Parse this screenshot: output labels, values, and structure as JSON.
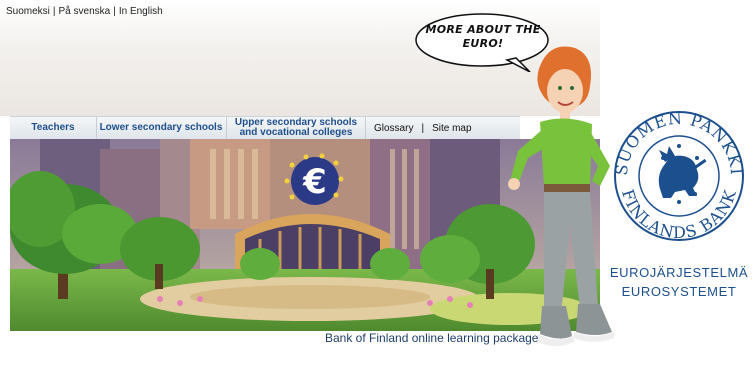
{
  "language_bar": {
    "items": [
      "Suomeksi",
      "På svenska",
      "In English"
    ],
    "separator": "|"
  },
  "nav": {
    "teachers": "Teachers",
    "lower_secondary": "Lower secondary schools",
    "upper_secondary": "Upper secondary schools and vocational colleges",
    "glossary": "Glossary",
    "separator": "|",
    "site_map": "Site map"
  },
  "speech_bubble": {
    "text": "MORE ABOUT THE EURO!"
  },
  "caption": "Bank of Finland online learning package",
  "logo": {
    "ring_text_top": "SUOMEN PANKKI",
    "ring_text_bottom": "FINLANDS BANK",
    "line1": "EUROJÄRJESTELMÄ",
    "line2": "EUROSYSTEMET",
    "color": "#1b4f8e"
  },
  "colors": {
    "nav_text": "#1f4f8a",
    "caption": "#1f3f6a"
  }
}
